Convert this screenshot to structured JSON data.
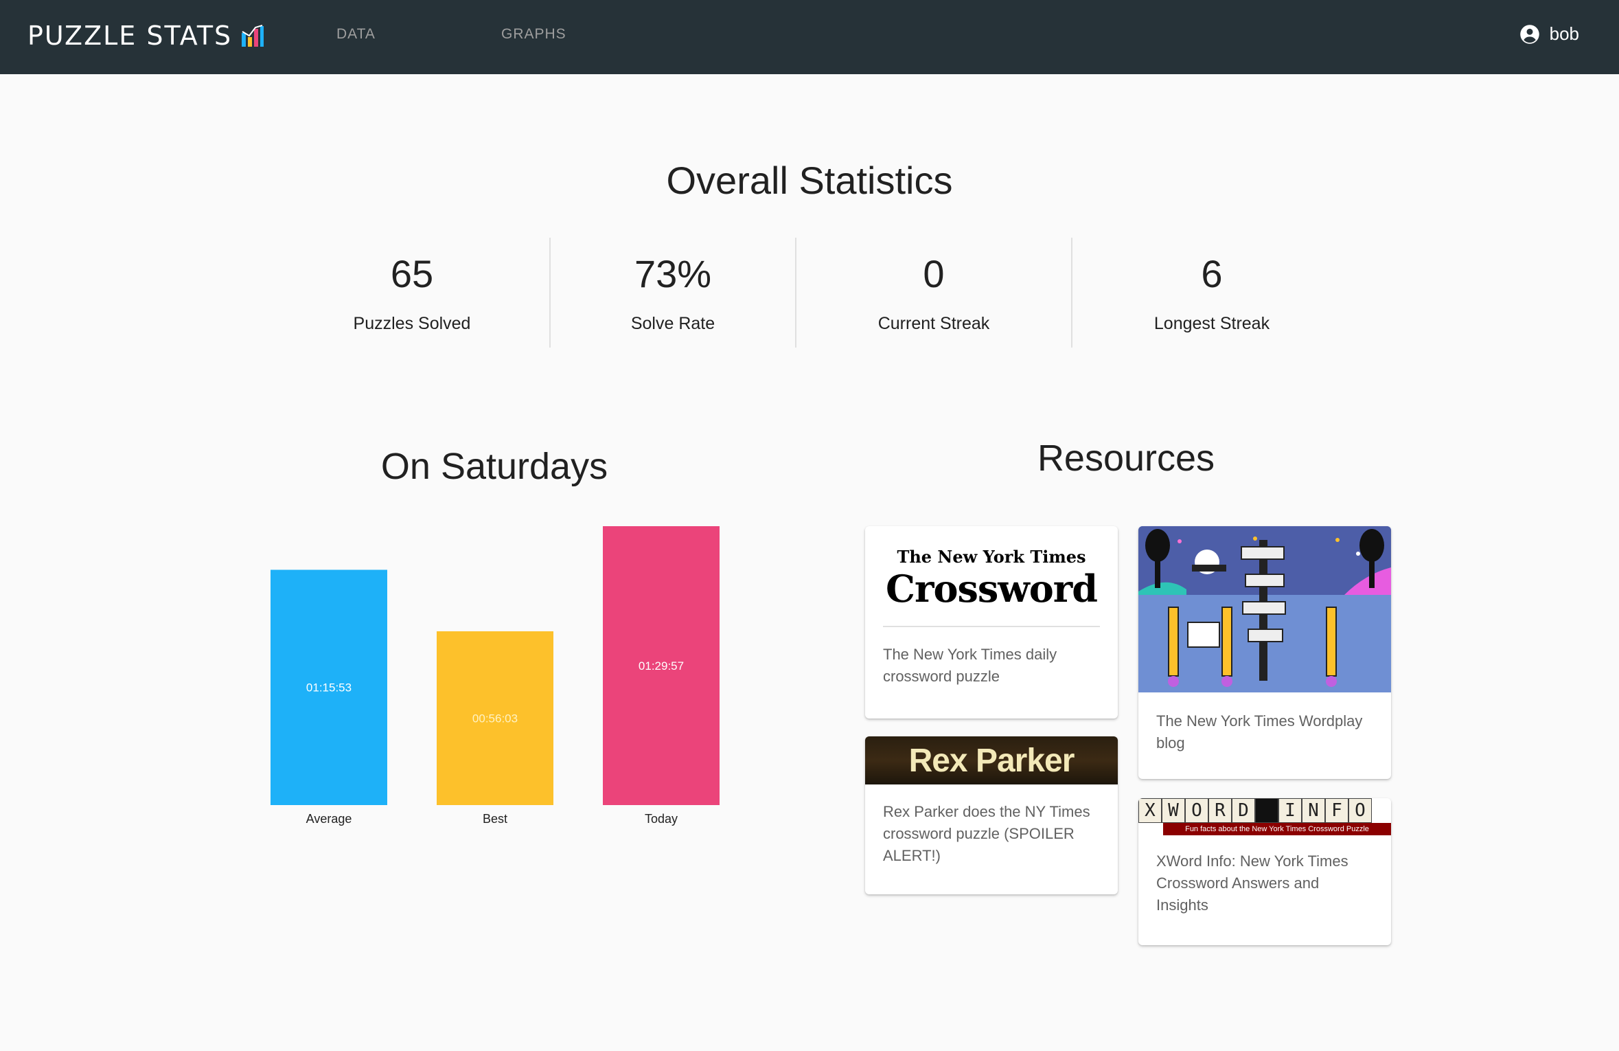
{
  "app": {
    "brand": "PUZZLE STATS",
    "brand_icon": "bar-chart-icon",
    "nav": [
      {
        "label": "DATA"
      },
      {
        "label": "GRAPHS"
      }
    ],
    "user": {
      "name": "bob",
      "icon": "account-circle-icon"
    }
  },
  "overall": {
    "title": "Overall Statistics",
    "stats": [
      {
        "value": "65",
        "label": "Puzzles Solved"
      },
      {
        "value": "73%",
        "label": "Solve Rate"
      },
      {
        "value": "0",
        "label": "Current Streak"
      },
      {
        "value": "6",
        "label": "Longest Streak"
      }
    ]
  },
  "saturdays": {
    "title": "On Saturdays"
  },
  "chart_data": {
    "type": "bar",
    "categories": [
      "Average",
      "Best",
      "Today"
    ],
    "values_seconds": [
      4553,
      3363,
      5397
    ],
    "value_labels": [
      "01:15:53",
      "00:56:03",
      "01:29:57"
    ],
    "colors": [
      "#1eb1f8",
      "#fdc12b",
      "#eb447a"
    ],
    "label_colors": [
      "#ffffff",
      "#fff3c4",
      "#ffffff"
    ],
    "ylim_seconds": [
      0,
      5397
    ],
    "title": "",
    "xlabel": "",
    "ylabel": "",
    "grid": false,
    "legend": "none"
  },
  "resources": {
    "title": "Resources",
    "cards": [
      {
        "name": "nyt-crossword",
        "logo_top": "The New York Times",
        "logo_main": "Crossword",
        "text": "The New York Times daily crossword puzzle"
      },
      {
        "name": "nyt-wordplay",
        "text": "The New York Times Wordplay blog"
      },
      {
        "name": "rex-parker",
        "logo": "Rex Parker",
        "text": "Rex Parker does the NY Times crossword puzzle (SPOILER ALERT!)"
      },
      {
        "name": "xword-info",
        "logo_letters": [
          "X",
          "W",
          "O",
          "R",
          "D",
          "",
          "I",
          "N",
          "F",
          "O"
        ],
        "logo_sub": "Fun facts about the New York Times Crossword Puzzle",
        "text": "XWord Info: New York Times Crossword Answers and Insights"
      }
    ]
  }
}
